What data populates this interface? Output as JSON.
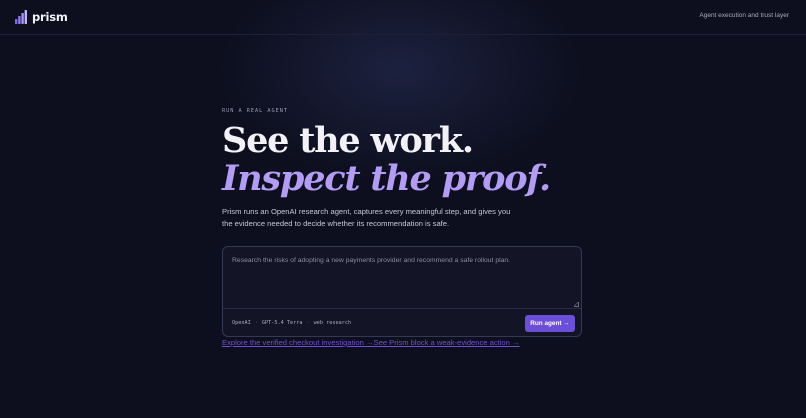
{
  "header": {
    "brand": "prism",
    "logo_icon": "bar-chart-logo-icon",
    "tagline": "Agent execution and trust layer"
  },
  "hero": {
    "eyebrow": "RUN A REAL AGENT",
    "headline_line1": "See the work.",
    "headline_line2": "Inspect the proof.",
    "description": "Prism runs an OpenAI research agent, captures every meaningful step, and gives you the evidence needed to decide whether its recommendation is safe."
  },
  "composer": {
    "placeholder": "Research the risks of adopting a new payments provider and recommend a safe rollout plan.",
    "value": "",
    "meta": [
      "OpenAI",
      "GPT-5.4 Terra",
      "web research"
    ],
    "run_label": "Run agent →"
  },
  "links": {
    "checkout": "Explore the verified checkout investigation →",
    "block": "See Prism block a weak-evidence action →"
  },
  "colors": {
    "background": "#0d0f1e",
    "accent": "#6b4fd8",
    "headline_accent": "#b39cf5",
    "link": "#6f4fd0"
  }
}
